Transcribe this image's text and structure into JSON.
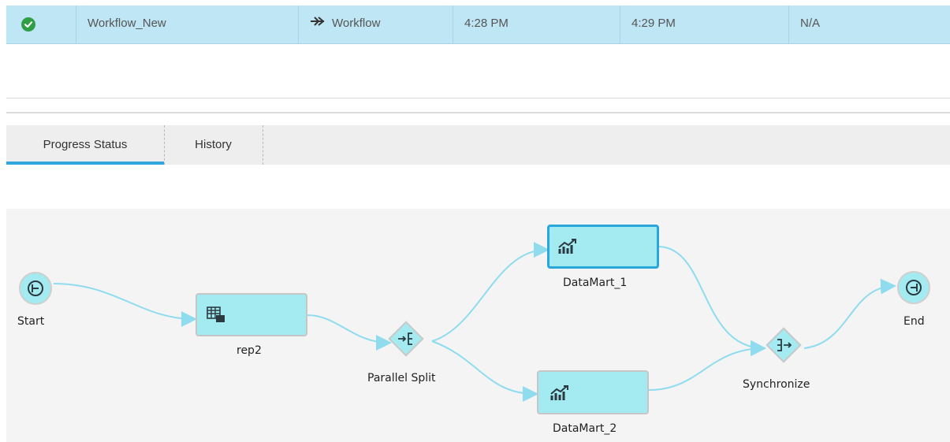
{
  "job_row": {
    "status_icon": "check-circle-icon",
    "name": "Workflow_New",
    "type_icon": "double-arrow-right-icon",
    "type": "Workflow",
    "start_time": "4:28 PM",
    "end_time": "4:29 PM",
    "extra": "N/A"
  },
  "tabs": [
    {
      "label": "Progress Status",
      "active": true
    },
    {
      "label": "History",
      "active": false
    }
  ],
  "workflow": {
    "nodes": {
      "start": "Start",
      "rep2": "rep2",
      "parallel_split": "Parallel Split",
      "datamart_1": "DataMart_1",
      "datamart_2": "DataMart_2",
      "synchronize": "Synchronize",
      "end": "End"
    }
  },
  "colors": {
    "row_highlight": "#bfe6f5",
    "node_fill": "#a3ebf1",
    "connector": "#8fdcef",
    "active_tab_underline": "#2fa6dc",
    "success": "#2f9e44"
  }
}
